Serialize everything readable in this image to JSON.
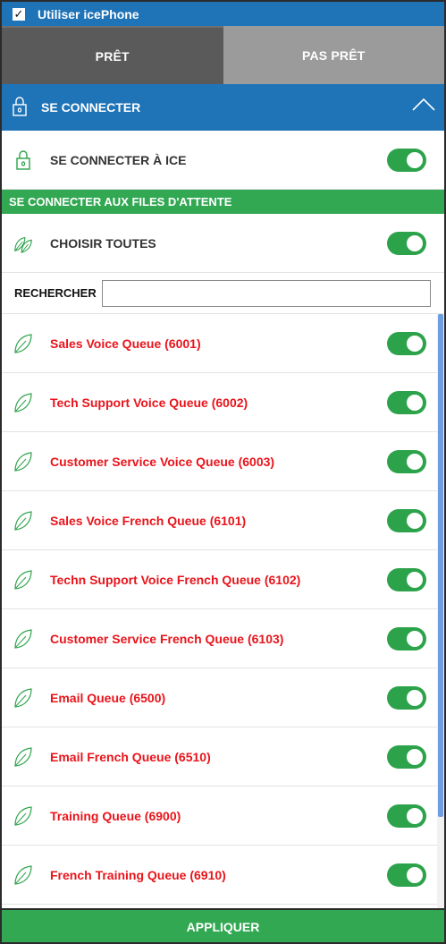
{
  "topbar": {
    "checkbox_checked": true,
    "label": "Utiliser icePhone"
  },
  "tabs": [
    {
      "label": "PRÊT",
      "active": true
    },
    {
      "label": "PAS PRÊT",
      "active": false
    }
  ],
  "connect_section": {
    "title": "SE CONNECTER",
    "icon": "lock-icon",
    "expanded": true
  },
  "connect_ice": {
    "label": "SE CONNECTER À ICE",
    "enabled": true
  },
  "queues_section": {
    "title": "SE CONNECTER AUX FILES D'ATTENTE"
  },
  "choose_all": {
    "label": "CHOISIR TOUTES",
    "enabled": true
  },
  "search": {
    "label": "RECHERCHER",
    "value": "",
    "placeholder": ""
  },
  "queues": [
    {
      "label": "Sales Voice Queue (6001)",
      "enabled": true
    },
    {
      "label": "Tech Support Voice Queue (6002)",
      "enabled": true
    },
    {
      "label": "Customer Service Voice Queue (6003)",
      "enabled": true
    },
    {
      "label": "Sales Voice French Queue (6101)",
      "enabled": true
    },
    {
      "label": "Techn Support Voice French Queue (6102)",
      "enabled": true
    },
    {
      "label": "Customer Service French Queue (6103)",
      "enabled": true
    },
    {
      "label": "Email Queue (6500)",
      "enabled": true
    },
    {
      "label": "Email French Queue (6510)",
      "enabled": true
    },
    {
      "label": "Training Queue (6900)",
      "enabled": true
    },
    {
      "label": "French Training Queue (6910)",
      "enabled": true
    }
  ],
  "apply": {
    "label": "APPLIQUER"
  },
  "colors": {
    "header_blue": "#1f73b7",
    "green": "#33a853",
    "toggle_green": "#2ca34b",
    "queue_red": "#e8141b",
    "tab_dark": "#5a5a5a",
    "tab_light": "#9b9b9b"
  }
}
